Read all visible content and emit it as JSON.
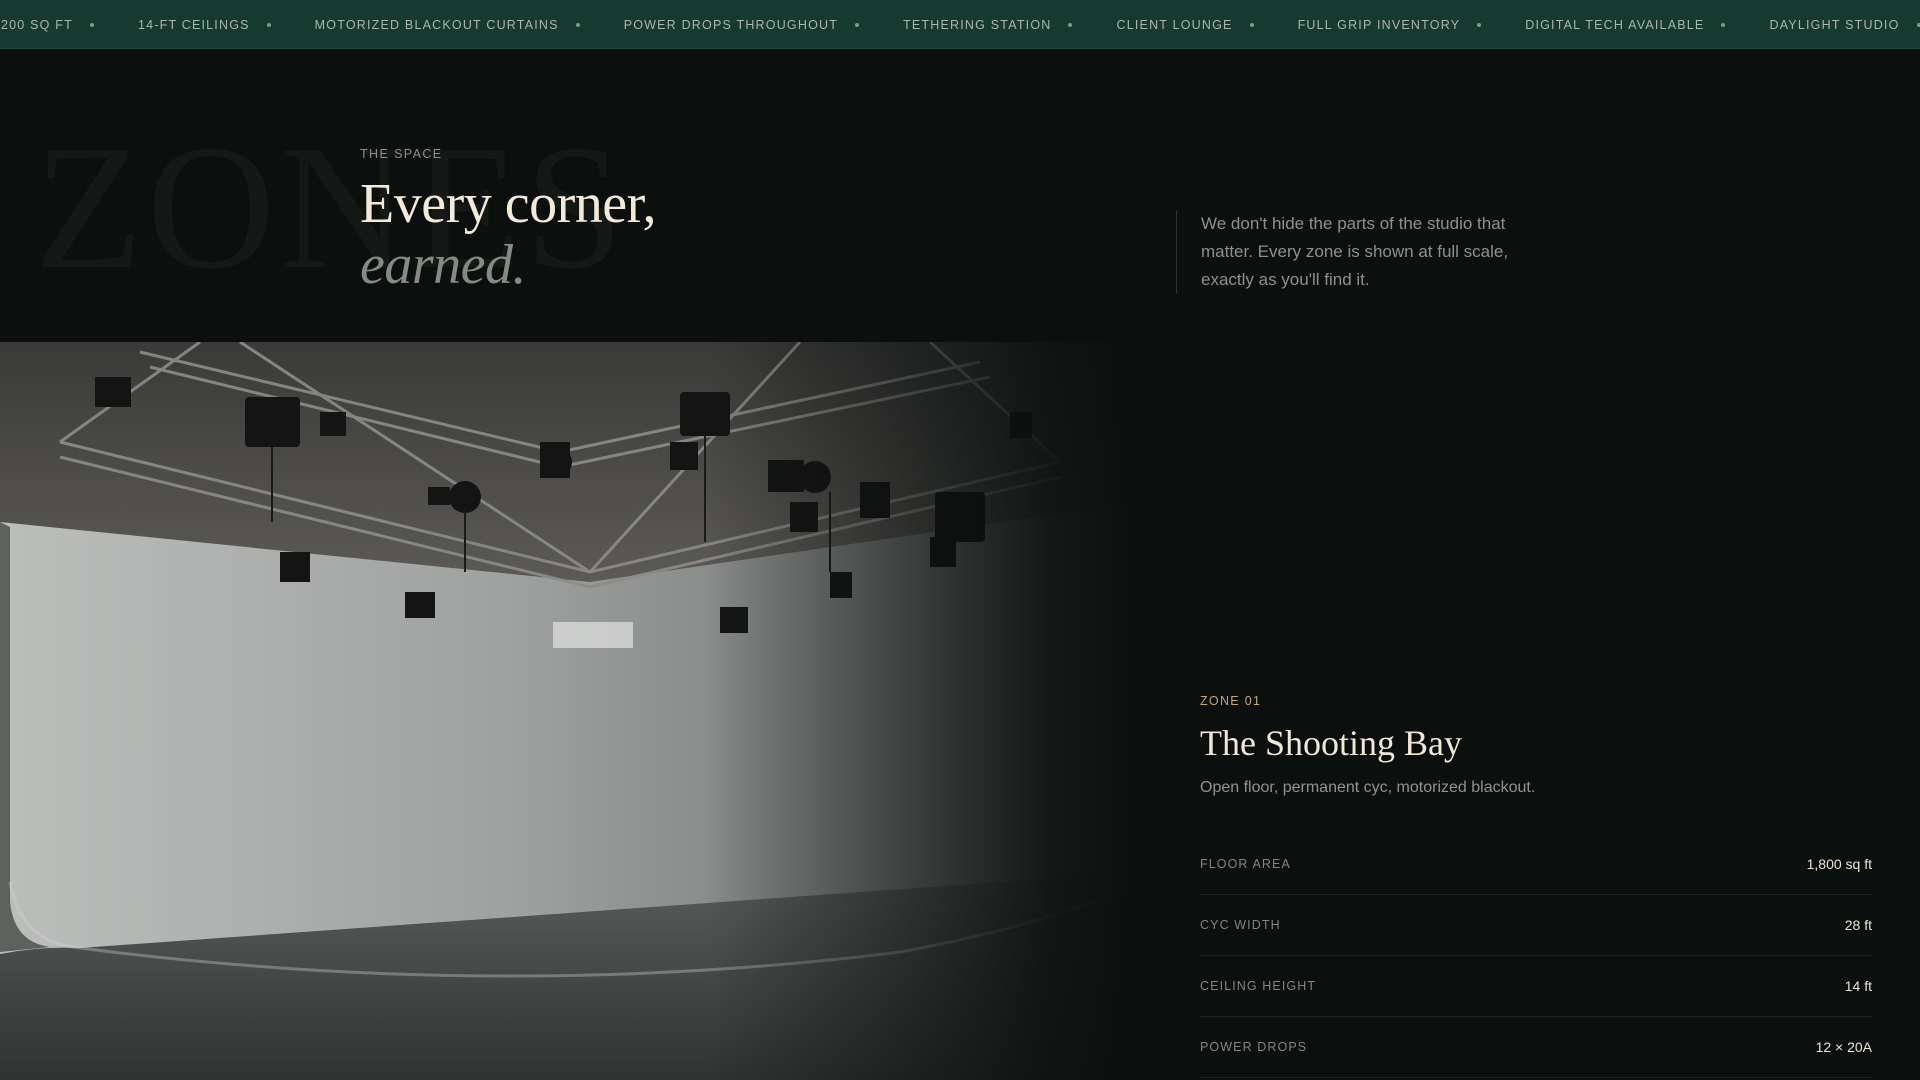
{
  "ticker": {
    "items": [
      "200 SQ FT",
      "14-FT CEILINGS",
      "MOTORIZED BLACKOUT CURTAINS",
      "POWER DROPS THROUGHOUT",
      "TETHERING STATION",
      "CLIENT LOUNGE",
      "FULL GRIP INVENTORY",
      "DIGITAL TECH AVAILABLE",
      "DAYLIGHT STUDIO"
    ]
  },
  "section": {
    "ghost_word": "ZONES",
    "eyebrow": "THE SPACE",
    "headline_line1": "Every corner,",
    "headline_line2": "earned.",
    "intro": "We don't hide the parts of the studio that matter. Every zone is shown at full scale, exactly as you'll find it."
  },
  "zone": {
    "label": "ZONE 01",
    "title": "The Shooting Bay",
    "description": "Open floor, permanent cyc, motorized blackout.",
    "specs": [
      {
        "key": "FLOOR AREA",
        "value": "1,800 sq ft"
      },
      {
        "key": "CYC WIDTH",
        "value": "28 ft"
      },
      {
        "key": "CEILING HEIGHT",
        "value": "14 ft"
      },
      {
        "key": "POWER DROPS",
        "value": "12 × 20A"
      }
    ]
  },
  "colors": {
    "background": "#0b0f0e",
    "ticker_bg": "#173a30",
    "accent_gold": "#c9a96a",
    "cream_text": "#f3ead8"
  }
}
